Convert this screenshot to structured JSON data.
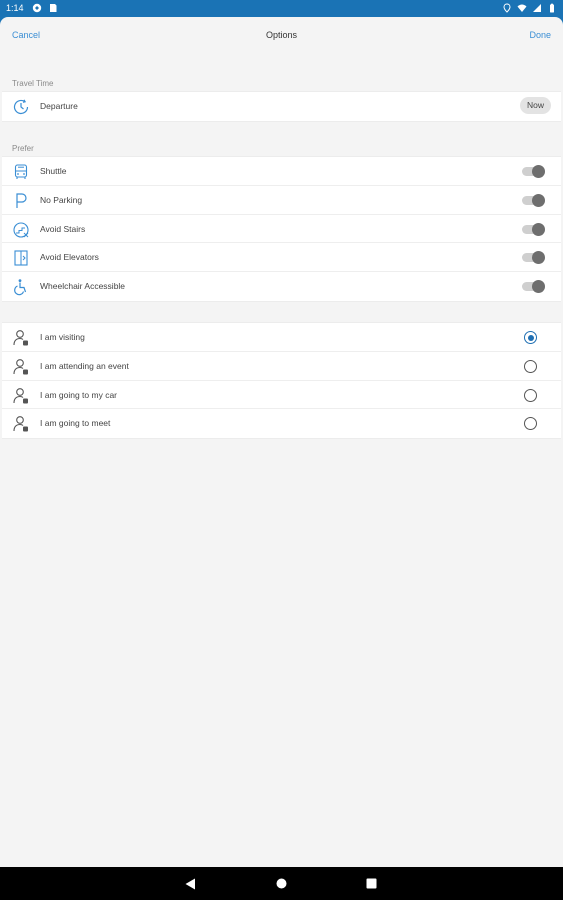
{
  "status": {
    "time": "1:14"
  },
  "nav": {
    "cancel": "Cancel",
    "title": "Options",
    "done": "Done"
  },
  "travel_time": {
    "header": "Travel Time",
    "departure_label": "Departure",
    "now_label": "Now"
  },
  "prefer": {
    "header": "Prefer",
    "items": [
      {
        "label": "Shuttle",
        "icon": "shuttle-icon",
        "on": false
      },
      {
        "label": "No Parking",
        "icon": "no-parking-icon",
        "on": false
      },
      {
        "label": "Avoid Stairs",
        "icon": "avoid-stairs-icon",
        "on": false
      },
      {
        "label": "Avoid Elevators",
        "icon": "avoid-elevators-icon",
        "on": false
      },
      {
        "label": "Wheelchair Accessible",
        "icon": "wheelchair-icon",
        "on": false
      }
    ]
  },
  "purpose": {
    "items": [
      {
        "label": "I am visiting",
        "icon": "person-icon",
        "selected": true
      },
      {
        "label": "I am attending an event",
        "icon": "person-icon",
        "selected": false
      },
      {
        "label": "I am going to my car",
        "icon": "person-icon",
        "selected": false
      },
      {
        "label": "I am going to meet",
        "icon": "person-icon",
        "selected": false
      }
    ]
  },
  "colors": {
    "accent": "#3a8ed4",
    "status_bar": "#1a73b5",
    "radio_selected": "#1f6fb3"
  }
}
